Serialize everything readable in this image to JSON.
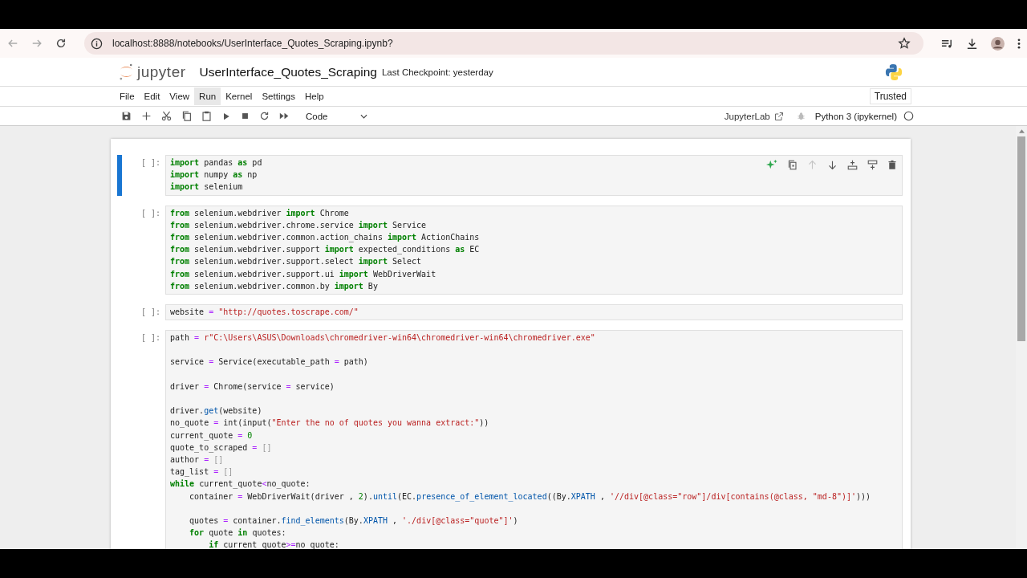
{
  "browser": {
    "url": "localhost:8888/notebooks/UserInterface_Quotes_Scraping.ipynb?"
  },
  "header": {
    "logo_text": "jupyter",
    "title": "UserInterface_Quotes_Scraping",
    "checkpoint": "Last Checkpoint: yesterday"
  },
  "menu": [
    {
      "label": "File",
      "selected": false
    },
    {
      "label": "Edit",
      "selected": false
    },
    {
      "label": "View",
      "selected": false
    },
    {
      "label": "Run",
      "selected": true
    },
    {
      "label": "Kernel",
      "selected": false
    },
    {
      "label": "Settings",
      "selected": false
    },
    {
      "label": "Help",
      "selected": false
    }
  ],
  "trusted": "Trusted",
  "toolbar": {
    "cell_type": "Code",
    "lab_link": "JupyterLab",
    "kernel": "Python 3 (ipykernel)",
    "kernel_busy": false
  },
  "cell_toolbar": [
    {
      "kind": "sparkle",
      "disabled": false
    },
    {
      "kind": "duplicate",
      "disabled": false
    },
    {
      "kind": "up",
      "disabled": true
    },
    {
      "kind": "down",
      "disabled": false
    },
    {
      "kind": "insert-above",
      "disabled": false
    },
    {
      "kind": "insert-below",
      "disabled": false
    },
    {
      "kind": "delete",
      "disabled": false
    }
  ],
  "cells": [
    {
      "prompt": "[ ]:",
      "active": true,
      "lines": [
        {
          "kind": "code",
          "tokens": [
            {
              "kind": "kw",
              "text": "import"
            },
            {
              "kind": "p",
              "text": " pandas "
            },
            {
              "kind": "kw",
              "text": "as"
            },
            {
              "kind": "p",
              "text": " pd"
            }
          ]
        },
        {
          "kind": "code",
          "tokens": [
            {
              "kind": "kw",
              "text": "import"
            },
            {
              "kind": "p",
              "text": " numpy "
            },
            {
              "kind": "kw",
              "text": "as"
            },
            {
              "kind": "p",
              "text": " np"
            }
          ]
        },
        {
          "kind": "code",
          "tokens": [
            {
              "kind": "kw",
              "text": "import"
            },
            {
              "kind": "p",
              "text": " selenium"
            }
          ]
        }
      ]
    },
    {
      "prompt": "[ ]:",
      "active": false,
      "lines": [
        {
          "kind": "code",
          "tokens": [
            {
              "kind": "kw",
              "text": "from"
            },
            {
              "kind": "p",
              "text": " selenium.webdriver "
            },
            {
              "kind": "kw",
              "text": "import"
            },
            {
              "kind": "p",
              "text": " Chrome"
            }
          ]
        },
        {
          "kind": "code",
          "tokens": [
            {
              "kind": "kw",
              "text": "from"
            },
            {
              "kind": "p",
              "text": " selenium.webdriver.chrome.service "
            },
            {
              "kind": "kw",
              "text": "import"
            },
            {
              "kind": "p",
              "text": " Service"
            }
          ]
        },
        {
          "kind": "code",
          "tokens": [
            {
              "kind": "kw",
              "text": "from"
            },
            {
              "kind": "p",
              "text": " selenium.webdriver.common.action_chains "
            },
            {
              "kind": "kw",
              "text": "import"
            },
            {
              "kind": "p",
              "text": " ActionChains"
            }
          ]
        },
        {
          "kind": "code",
          "tokens": [
            {
              "kind": "kw",
              "text": "from"
            },
            {
              "kind": "p",
              "text": " selenium.webdriver.support "
            },
            {
              "kind": "kw",
              "text": "import"
            },
            {
              "kind": "p",
              "text": " expected_conditions "
            },
            {
              "kind": "kw",
              "text": "as"
            },
            {
              "kind": "p",
              "text": " EC"
            }
          ]
        },
        {
          "kind": "code",
          "tokens": [
            {
              "kind": "kw",
              "text": "from"
            },
            {
              "kind": "p",
              "text": " selenium.webdriver.support.select "
            },
            {
              "kind": "kw",
              "text": "import"
            },
            {
              "kind": "p",
              "text": " Select"
            }
          ]
        },
        {
          "kind": "code",
          "tokens": [
            {
              "kind": "kw",
              "text": "from"
            },
            {
              "kind": "p",
              "text": " selenium.webdriver.support.ui "
            },
            {
              "kind": "kw",
              "text": "import"
            },
            {
              "kind": "p",
              "text": " WebDriverWait"
            }
          ]
        },
        {
          "kind": "code",
          "tokens": [
            {
              "kind": "kw",
              "text": "from"
            },
            {
              "kind": "p",
              "text": " selenium.webdriver.common.by "
            },
            {
              "kind": "kw",
              "text": "import"
            },
            {
              "kind": "p",
              "text": " By"
            }
          ]
        }
      ]
    },
    {
      "prompt": "[ ]:",
      "active": false,
      "lines": [
        {
          "kind": "code",
          "tokens": [
            {
              "kind": "p",
              "text": "website "
            },
            {
              "kind": "op",
              "text": "= "
            },
            {
              "kind": "str",
              "text": "\"http://quotes.toscrape.com/\""
            }
          ]
        }
      ]
    },
    {
      "prompt": "[ ]:",
      "active": false,
      "lines": [
        {
          "kind": "code",
          "tokens": [
            {
              "kind": "p",
              "text": "path "
            },
            {
              "kind": "op",
              "text": "= "
            },
            {
              "kind": "str",
              "text": "r\"C:\\Users\\ASUS\\Downloads\\chromedriver-win64\\chromedriver-win64\\chromedriver.exe\""
            }
          ]
        },
        {
          "kind": "blank"
        },
        {
          "kind": "code",
          "tokens": [
            {
              "kind": "p",
              "text": "service "
            },
            {
              "kind": "op",
              "text": "="
            },
            {
              "kind": "p",
              "text": " Service(executable_path "
            },
            {
              "kind": "op",
              "text": "="
            },
            {
              "kind": "p",
              "text": " path)"
            }
          ]
        },
        {
          "kind": "blank"
        },
        {
          "kind": "code",
          "tokens": [
            {
              "kind": "p",
              "text": "driver "
            },
            {
              "kind": "op",
              "text": "="
            },
            {
              "kind": "p",
              "text": " Chrome(service "
            },
            {
              "kind": "op",
              "text": "="
            },
            {
              "kind": "p",
              "text": " service)"
            }
          ]
        },
        {
          "kind": "blank"
        },
        {
          "kind": "code",
          "tokens": [
            {
              "kind": "p",
              "text": "driver."
            },
            {
              "kind": "fn",
              "text": "get"
            },
            {
              "kind": "p",
              "text": "(website)"
            }
          ]
        },
        {
          "kind": "code",
          "tokens": [
            {
              "kind": "p",
              "text": "no_quote "
            },
            {
              "kind": "op",
              "text": "="
            },
            {
              "kind": "p",
              "text": " int(input("
            },
            {
              "kind": "str",
              "text": "\"Enter the no of quotes you wanna extract:\""
            },
            {
              "kind": "p",
              "text": "))"
            }
          ]
        },
        {
          "kind": "code",
          "tokens": [
            {
              "kind": "p",
              "text": "current_quote "
            },
            {
              "kind": "op",
              "text": "= "
            },
            {
              "kind": "num",
              "text": "0"
            }
          ]
        },
        {
          "kind": "code",
          "tokens": [
            {
              "kind": "p",
              "text": "quote_to_scraped "
            },
            {
              "kind": "op",
              "text": "= "
            },
            {
              "kind": "br",
              "text": "[]"
            }
          ]
        },
        {
          "kind": "code",
          "tokens": [
            {
              "kind": "p",
              "text": "author "
            },
            {
              "kind": "op",
              "text": "= "
            },
            {
              "kind": "br",
              "text": "[]"
            }
          ]
        },
        {
          "kind": "code",
          "tokens": [
            {
              "kind": "p",
              "text": "tag_list "
            },
            {
              "kind": "op",
              "text": "= "
            },
            {
              "kind": "br",
              "text": "[]"
            }
          ]
        },
        {
          "kind": "code",
          "tokens": [
            {
              "kind": "kw",
              "text": "while"
            },
            {
              "kind": "p",
              "text": " current_quote"
            },
            {
              "kind": "op",
              "text": "<"
            },
            {
              "kind": "p",
              "text": "no_quote:"
            }
          ]
        },
        {
          "kind": "code",
          "tokens": [
            {
              "kind": "p",
              "text": "    container "
            },
            {
              "kind": "op",
              "text": "="
            },
            {
              "kind": "p",
              "text": " WebDriverWait(driver , "
            },
            {
              "kind": "num",
              "text": "2"
            },
            {
              "kind": "p",
              "text": ")."
            },
            {
              "kind": "fn",
              "text": "until"
            },
            {
              "kind": "p",
              "text": "(EC."
            },
            {
              "kind": "fn",
              "text": "presence_of_element_located"
            },
            {
              "kind": "p",
              "text": "((By."
            },
            {
              "kind": "fn",
              "text": "XPATH"
            },
            {
              "kind": "p",
              "text": " , "
            },
            {
              "kind": "str",
              "text": "'//div[@class=\"row\"]/div[contains(@class, \"md-8\")]'"
            },
            {
              "kind": "p",
              "text": ")))"
            }
          ]
        },
        {
          "kind": "blank"
        },
        {
          "kind": "code",
          "tokens": [
            {
              "kind": "p",
              "text": "    quotes "
            },
            {
              "kind": "op",
              "text": "="
            },
            {
              "kind": "p",
              "text": " container."
            },
            {
              "kind": "fn",
              "text": "find_elements"
            },
            {
              "kind": "p",
              "text": "(By."
            },
            {
              "kind": "fn",
              "text": "XPATH"
            },
            {
              "kind": "p",
              "text": " , "
            },
            {
              "kind": "str",
              "text": "'./div[@class=\"quote\"]'"
            },
            {
              "kind": "p",
              "text": ")"
            }
          ]
        },
        {
          "kind": "code",
          "tokens": [
            {
              "kind": "kw",
              "text": "    for"
            },
            {
              "kind": "p",
              "text": " quote "
            },
            {
              "kind": "kw",
              "text": "in"
            },
            {
              "kind": "p",
              "text": " quotes:"
            }
          ]
        },
        {
          "kind": "code",
          "tokens": [
            {
              "kind": "kw",
              "text": "        if"
            },
            {
              "kind": "p",
              "text": " current_quote"
            },
            {
              "kind": "op",
              "text": ">="
            },
            {
              "kind": "p",
              "text": "no_quote:"
            }
          ]
        }
      ]
    }
  ]
}
